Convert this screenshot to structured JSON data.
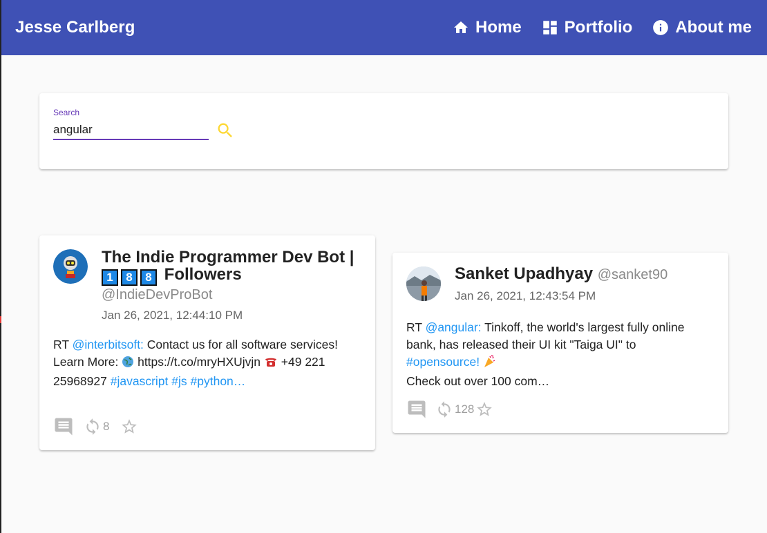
{
  "header": {
    "brand": "Jesse Carlberg",
    "nav": [
      {
        "label": "Home",
        "icon": "home-icon"
      },
      {
        "label": "Portfolio",
        "icon": "dashboard-icon"
      },
      {
        "label": "About me",
        "icon": "info-icon"
      }
    ],
    "color": "#3f51b5"
  },
  "search": {
    "label": "Search",
    "value": "angular",
    "accent": "#673ab7",
    "button_icon": "search-icon",
    "button_color": "#fdd835"
  },
  "tweets": [
    {
      "name_text": "The Indie Programmer Dev Bot |",
      "name_digits": [
        "1",
        "8",
        "8"
      ],
      "name_suffix": "Followers",
      "handle": "@IndieDevProBot",
      "date": "Jan 26, 2021, 12:44:10 PM",
      "body": {
        "prefix": "RT ",
        "mention": "@interbitsoft:",
        "text1": " Contact us for all software services! Learn More: ",
        "text2": " https://t.co/mryHXUjvjn ",
        "text3": " +49 221 25968927 ",
        "tag1": "#javascript",
        "tag2": "#js",
        "tag3": "#python…"
      },
      "retweets": "8",
      "favorites": ""
    },
    {
      "name_text": "Sanket Upadhyay",
      "handle": "@sanket90",
      "date": "Jan 26, 2021, 12:43:54 PM",
      "body": {
        "prefix": "RT ",
        "mention": "@angular:",
        "text1": " Tinkoff, the world's largest fully online bank, has released their UI kit \"Taiga UI\" to ",
        "tag1": "#opensource!",
        "text2": "Check out over 100 com…"
      },
      "retweets": "128",
      "favorites": ""
    }
  ],
  "colors": {
    "link": "#2196f3",
    "icon_gray": "#bdbdbd"
  }
}
